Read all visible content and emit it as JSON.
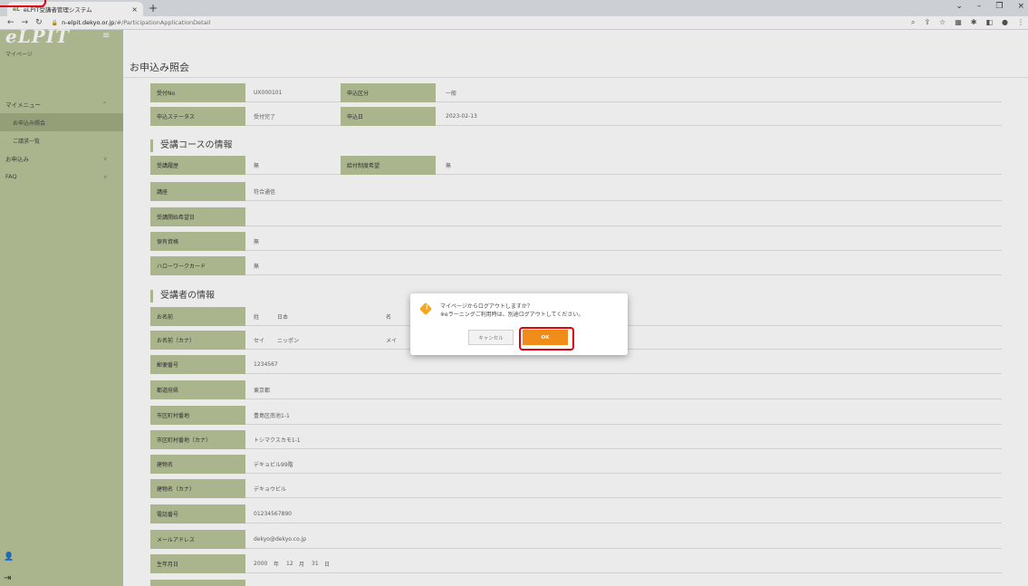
{
  "browser": {
    "tab_title": "eLPIT受講者管理システム",
    "tab_favicon": "eL",
    "url_host": "n-elpit.dekyo.or.jp",
    "url_path": "/#/ParticipationApplicationDetail"
  },
  "app": {
    "brand": "eLPIT",
    "mypage_label": "マイページ"
  },
  "sidebar": {
    "items": [
      {
        "label": "マイメニュー",
        "chevron": "^"
      },
      {
        "label": "お申込み照会"
      },
      {
        "label": "ご請求一覧"
      },
      {
        "label": "お申込み",
        "chevron": "v"
      },
      {
        "label": "FAQ",
        "chevron": "v"
      }
    ]
  },
  "page": {
    "title": "お申込み照会"
  },
  "summary": {
    "receipt_no_label": "受付No",
    "receipt_no": "UX000101",
    "category_label": "申込区分",
    "category": "一般",
    "status_label": "申込ステータス",
    "status": "受付完了",
    "date_label": "申込日",
    "date": "2023-02-13"
  },
  "course": {
    "section_title": "受講コースの情報",
    "hist_label": "受講履歴",
    "hist": "無",
    "grant_label": "給付制度希望",
    "grant": "無",
    "lecture_label": "講座",
    "lecture": "符合通信",
    "start_label": "受講開始希望日",
    "start": "",
    "qual_label": "保有資格",
    "qual": "無",
    "hw_label": "ハローワークカード",
    "hw": "無"
  },
  "student": {
    "section_title": "受講者の情報",
    "name_label": "お名前",
    "sei_label": "姓",
    "sei": "日本",
    "mei_label": "名",
    "kana_label": "お名前（カナ）",
    "sei_kana_label": "セイ",
    "sei_kana": "ニッポン",
    "mei_kana_label": "メイ",
    "zip_label": "郵便番号",
    "zip": "1234567",
    "pref_label": "都道府県",
    "pref": "東京都",
    "city_label": "市区町村番地",
    "city": "豊島区南池1-1",
    "city_kana_label": "市区町村番地（カナ）",
    "city_kana": "トシマクスカモ1-1",
    "bldg_label": "建物名",
    "bldg": "デキョビル99階",
    "bldg_kana_label": "建物名（カナ）",
    "bldg_kana": "デキョウビル",
    "tel_label": "電話番号",
    "tel": "01234567890",
    "mail_label": "メールアドレス",
    "mail": "dekyo@dekyo.co.jp",
    "birth_label": "生年月日",
    "birth_year": "2000",
    "birth_year_unit": "年",
    "birth_month": "12",
    "birth_month_unit": "月",
    "birth_day": "31",
    "birth_day_unit": "日"
  },
  "dialog": {
    "line1": "マイページからログアウトしますか？",
    "line2": "※eラーニングご利用時は、別途ログアウトしてください。",
    "cancel_label": "キャンセル",
    "ok_label": "OK"
  },
  "colors": {
    "sidebar": "#b9c49a",
    "label_bg": "#b9c49a",
    "ok_button": "#f08c1a",
    "highlight": "#e1000f"
  }
}
